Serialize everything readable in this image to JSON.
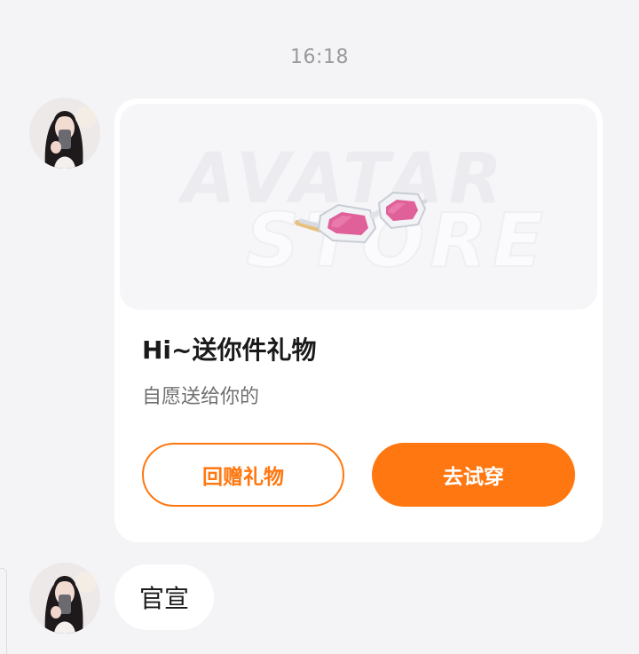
{
  "chat": {
    "timestamp": "16:18",
    "gift_card": {
      "banner_watermark_line1": "AVATAR",
      "banner_watermark_line2": "STORE",
      "item_icon": "pink-sunglasses-icon",
      "title": "Hi~送你件礼物",
      "subtitle": "自愿送给你的",
      "return_gift_label": "回赠礼物",
      "try_on_label": "去试穿",
      "accent_color": "#ff7710"
    },
    "text_message": "官宣"
  }
}
